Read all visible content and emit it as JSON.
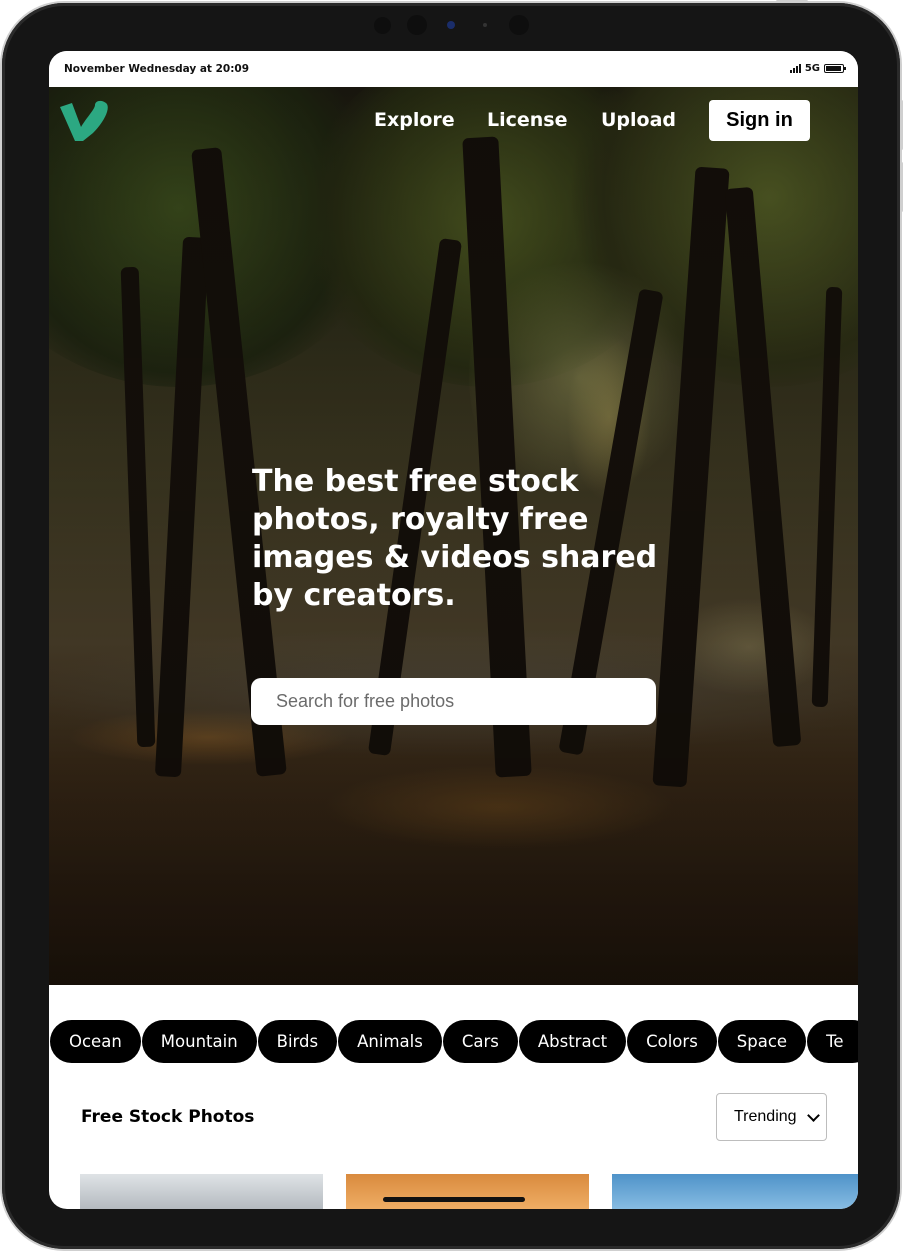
{
  "status_bar": {
    "time": "November Wednesday at 20:09",
    "network": "5G"
  },
  "colors": {
    "brand": "#1ab7ea",
    "logo": "#2ca882",
    "chip_bg": "#000000",
    "button_bg": "#ffffff"
  },
  "header": {
    "logo_icon": "vimeo-v-logo",
    "nav": [
      "Explore",
      "License",
      "Upload"
    ],
    "signin_label": "Sign in"
  },
  "hero": {
    "headline": "The best free stock photos, royalty free images & videos shared by creators.",
    "search_placeholder": "Search for free photos"
  },
  "categories": [
    "Ocean",
    "Mountain",
    "Birds",
    "Animals",
    "Cars",
    "Abstract",
    "Colors",
    "Space",
    "Te"
  ],
  "section": {
    "title": "Free Stock Photos",
    "sort_selected": "Trending"
  }
}
